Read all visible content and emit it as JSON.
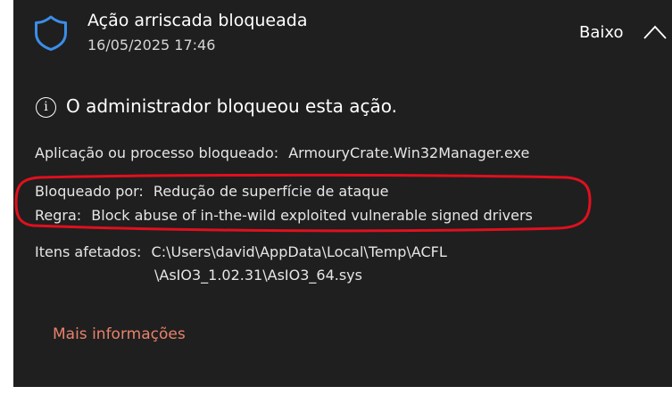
{
  "header": {
    "title": "Ação arriscada bloqueada",
    "timestamp": "16/05/2025 17:46",
    "severity": "Baixo",
    "icon": "shield-icon"
  },
  "notice": {
    "text": "O administrador bloqueou esta ação.",
    "icon": "info-icon"
  },
  "details": {
    "app_label": "Aplicação ou processo bloqueado:",
    "app_value": "ArmouryCrate.Win32Manager.exe",
    "blocked_by_label": "Bloqueado por:",
    "blocked_by_value": "Redução de superfície de ataque",
    "rule_label": "Regra:",
    "rule_value": "Block abuse of in-the-wild exploited vulnerable signed drivers",
    "items_label": "Itens afetados:",
    "items_value_line1": "C:\\Users\\david\\AppData\\Local\\Temp\\ACFL",
    "items_value_line2": "\\AsIO3_1.02.31\\AsIO3_64.sys"
  },
  "link": {
    "more_info": "Mais informações"
  },
  "colors": {
    "panel_bg": "#1f1f1f",
    "accent_blue": "#3b8ee8",
    "link": "#e8826c",
    "annotation_red": "#e0101e"
  }
}
